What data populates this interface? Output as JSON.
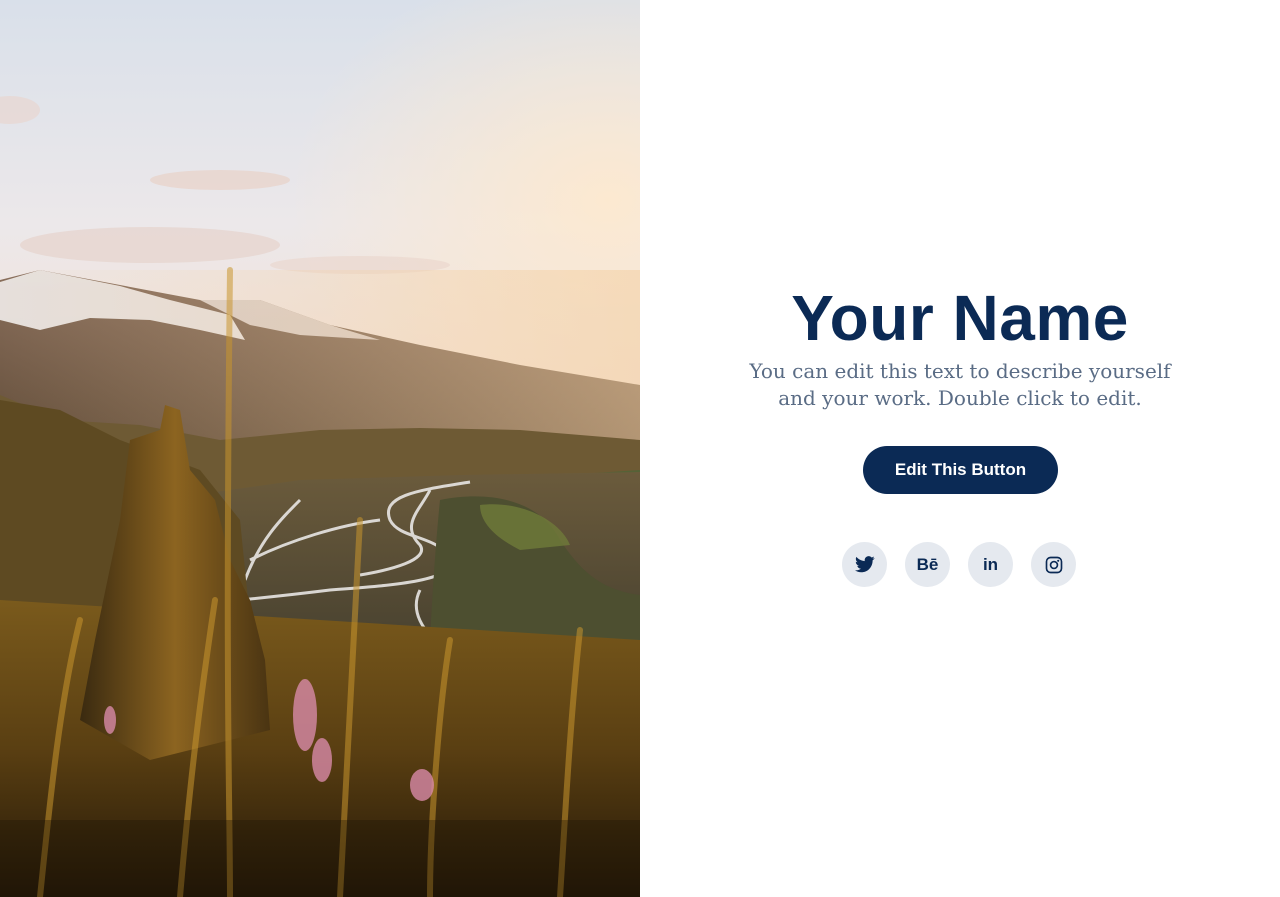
{
  "hero_image": {
    "subject": "mountain-valley-sunset-photo"
  },
  "profile": {
    "name": "Your Name",
    "bio": "You can edit this text to describe yourself and your work. Double click to edit."
  },
  "cta": {
    "label": "Edit This Button"
  },
  "socials": [
    {
      "icon": "twitter-icon",
      "label": ""
    },
    {
      "icon": "behance-icon",
      "label": "Bē"
    },
    {
      "icon": "linkedin-icon",
      "label": "in"
    },
    {
      "icon": "instagram-icon",
      "label": ""
    }
  ],
  "colors": {
    "primary": "#0b2a55",
    "bio_text": "#5a6c85",
    "social_bg": "#e5e9ef",
    "background": "#ffffff"
  }
}
